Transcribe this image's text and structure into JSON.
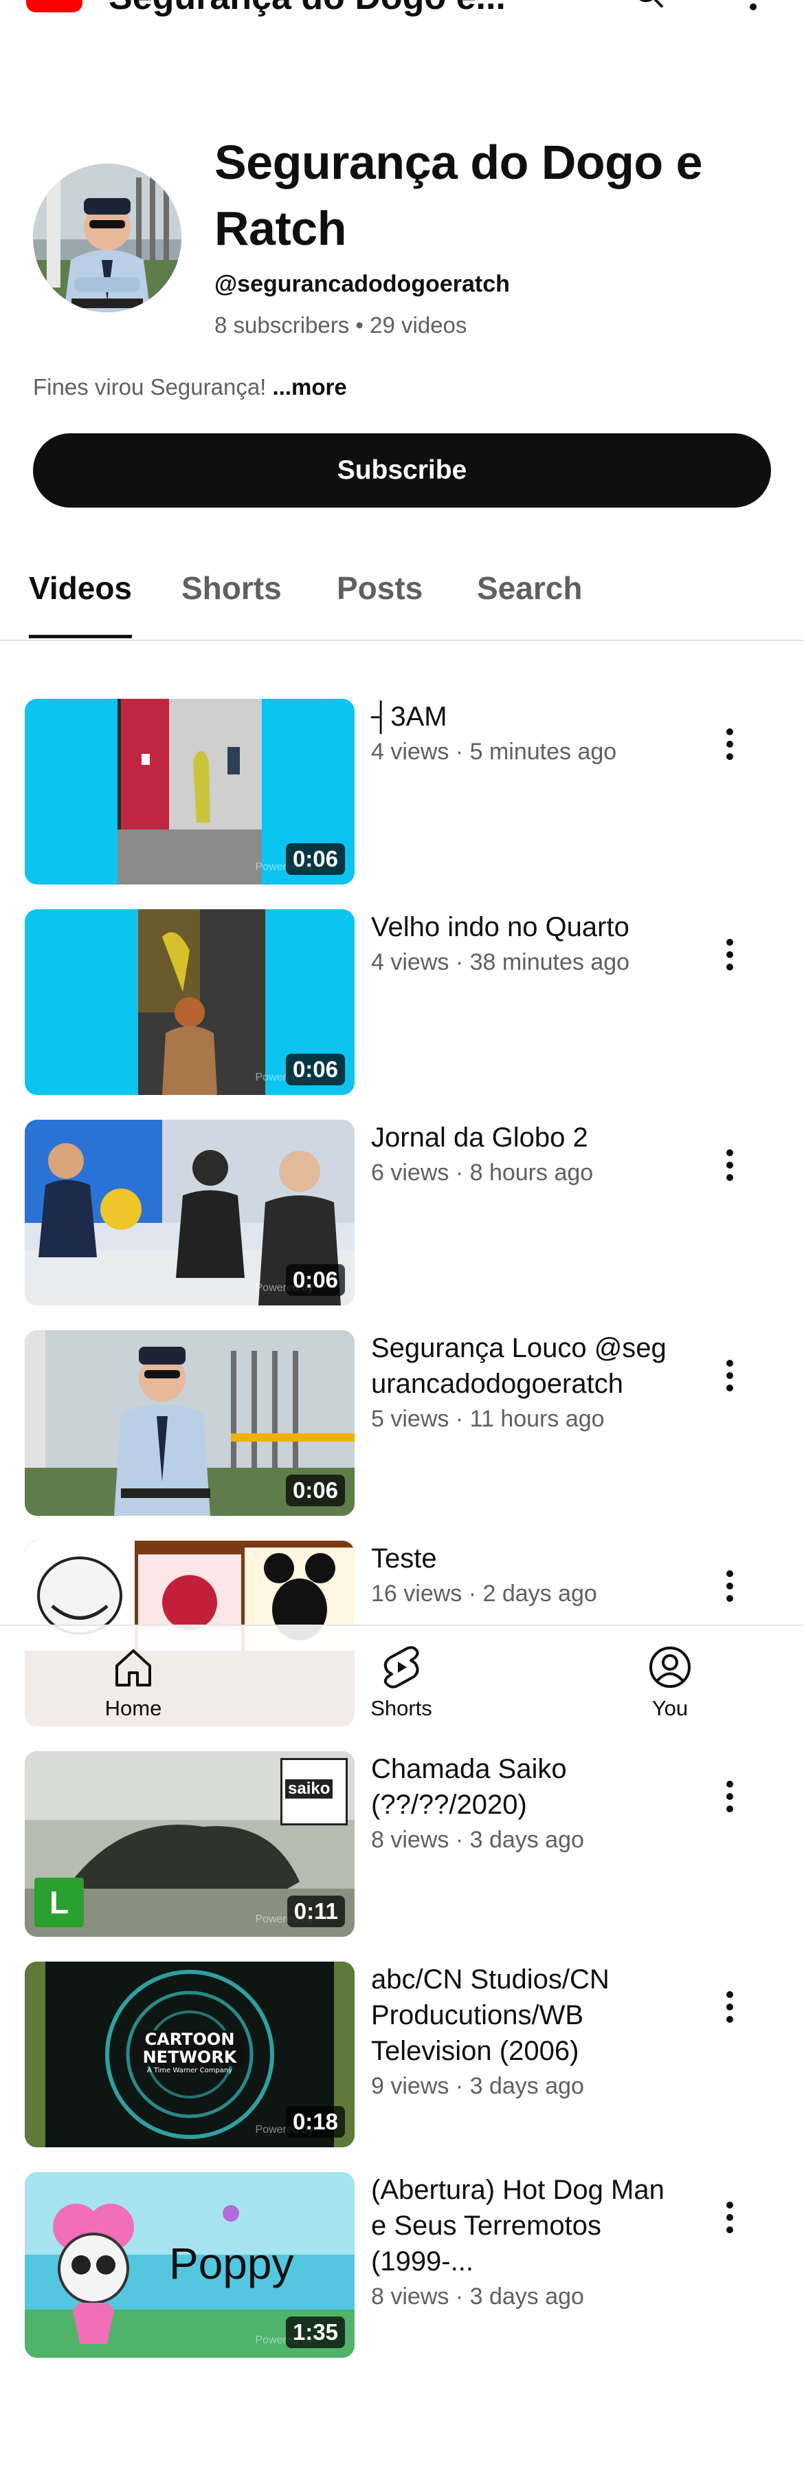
{
  "header": {
    "title": "Segurança do Dogo e..."
  },
  "channel": {
    "name": "Segurança do Dogo e Ratch",
    "handle": "@segurancadodogoeratch",
    "stats": "8 subscribers • 29 videos",
    "description": "Fines virou Segurança!",
    "more_label": "...more",
    "subscribe_label": "Subscribe"
  },
  "tabs": [
    "Videos",
    "Shorts",
    "Posts",
    "Search"
  ],
  "videos": [
    {
      "title": "┤3AM",
      "meta": "4 views · 5 minutes ago",
      "duration": "0:06"
    },
    {
      "title": "Velho indo no Quarto",
      "meta": "4 views · 38 minutes ago",
      "duration": "0:06"
    },
    {
      "title": "Jornal da Globo 2",
      "meta": "6 views · 8 hours ago",
      "duration": "0:06"
    },
    {
      "title": "Segurança Louco @segurancadodogoeratch",
      "meta": "5 views · 11 hours ago",
      "duration": "0:06"
    },
    {
      "title": "Teste",
      "meta": "16 views · 2 days ago",
      "duration": ""
    },
    {
      "title": "Chamada Saiko (??/??/2020)",
      "meta": "8 views · 3 days ago",
      "duration": "0:11"
    },
    {
      "title": "abc/CN Studios/CN Producutions/WB Television (2006)",
      "meta": "9 views · 3 days ago",
      "duration": "0:18"
    },
    {
      "title": "(Abertura) Hot Dog Man e Seus Terremotos (1999-...",
      "meta": "8 views · 3 days ago",
      "duration": "1:35"
    }
  ],
  "thumb_text": {
    "saiko": "saiko",
    "letter": "L",
    "cn_top": "CARTOON",
    "cn_bottom": "NETWORK",
    "cn_sub": "A Time Warner Company",
    "poppy": "Poppy",
    "powered": "Powered by"
  },
  "bottom_nav": [
    {
      "label": "Home",
      "icon": "home-icon"
    },
    {
      "label": "Shorts",
      "icon": "shorts-icon"
    },
    {
      "label": "You",
      "icon": "you-icon"
    }
  ],
  "colors": {
    "accent": "#0f0f0f",
    "brand": "#ff0000",
    "secondary_text": "#606060",
    "thumb_bg": "#0bc4f0"
  }
}
